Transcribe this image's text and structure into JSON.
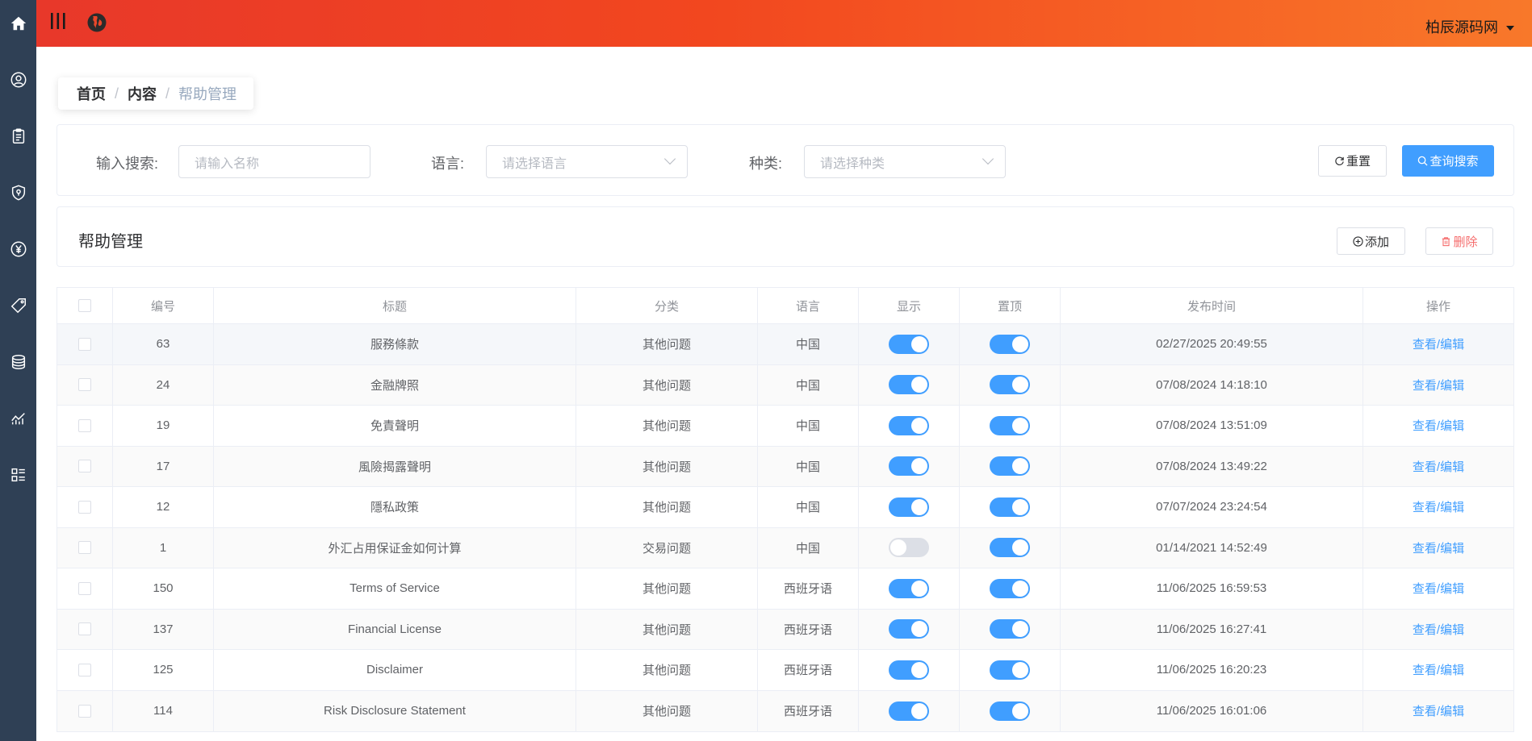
{
  "header": {
    "user_name": "柏辰源码网"
  },
  "breadcrumb": {
    "home": "首页",
    "section": "内容",
    "current": "帮助管理",
    "sep": "/"
  },
  "search": {
    "keyword_label": "输入搜索:",
    "keyword_placeholder": "请输入名称",
    "language_label": "语言:",
    "language_placeholder": "请选择语言",
    "category_label": "种类:",
    "category_placeholder": "请选择种类",
    "reset_label": "重置",
    "search_label": "查询搜索"
  },
  "panel": {
    "title": "帮助管理",
    "add_label": "添加",
    "delete_label": "删除"
  },
  "table": {
    "columns": [
      "编号",
      "标题",
      "分类",
      "语言",
      "显示",
      "置顶",
      "发布时间",
      "操作"
    ],
    "action_label": "查看/编辑",
    "rows": [
      {
        "id": "63",
        "title": "服務條款",
        "category": "其他问题",
        "language": "中国",
        "show": true,
        "top": true,
        "time": "02/27/2025 20:49:55"
      },
      {
        "id": "24",
        "title": "金融牌照",
        "category": "其他问题",
        "language": "中国",
        "show": true,
        "top": true,
        "time": "07/08/2024 14:18:10"
      },
      {
        "id": "19",
        "title": "免責聲明",
        "category": "其他问题",
        "language": "中国",
        "show": true,
        "top": true,
        "time": "07/08/2024 13:51:09"
      },
      {
        "id": "17",
        "title": "風險揭露聲明",
        "category": "其他问题",
        "language": "中国",
        "show": true,
        "top": true,
        "time": "07/08/2024 13:49:22"
      },
      {
        "id": "12",
        "title": "隱私政策",
        "category": "其他问题",
        "language": "中国",
        "show": true,
        "top": true,
        "time": "07/07/2024 23:24:54"
      },
      {
        "id": "1",
        "title": "外汇占用保证金如何计算",
        "category": "交易问题",
        "language": "中国",
        "show": false,
        "top": true,
        "time": "01/14/2021 14:52:49"
      },
      {
        "id": "150",
        "title": "Terms of Service",
        "category": "其他问题",
        "language": "西班牙语",
        "show": true,
        "top": true,
        "time": "11/06/2025 16:59:53"
      },
      {
        "id": "137",
        "title": "Financial License",
        "category": "其他问题",
        "language": "西班牙语",
        "show": true,
        "top": true,
        "time": "11/06/2025 16:27:41"
      },
      {
        "id": "125",
        "title": "Disclaimer",
        "category": "其他问题",
        "language": "西班牙语",
        "show": true,
        "top": true,
        "time": "11/06/2025 16:20:23"
      },
      {
        "id": "114",
        "title": "Risk Disclosure Statement",
        "category": "其他问题",
        "language": "西班牙语",
        "show": true,
        "top": true,
        "time": "11/06/2025 16:01:06"
      }
    ]
  },
  "colors": {
    "sidebar": "#2f4055",
    "primary": "#409eff",
    "danger": "#f56c6c",
    "header_start": "#e8382a",
    "header_end": "#f8782a"
  }
}
